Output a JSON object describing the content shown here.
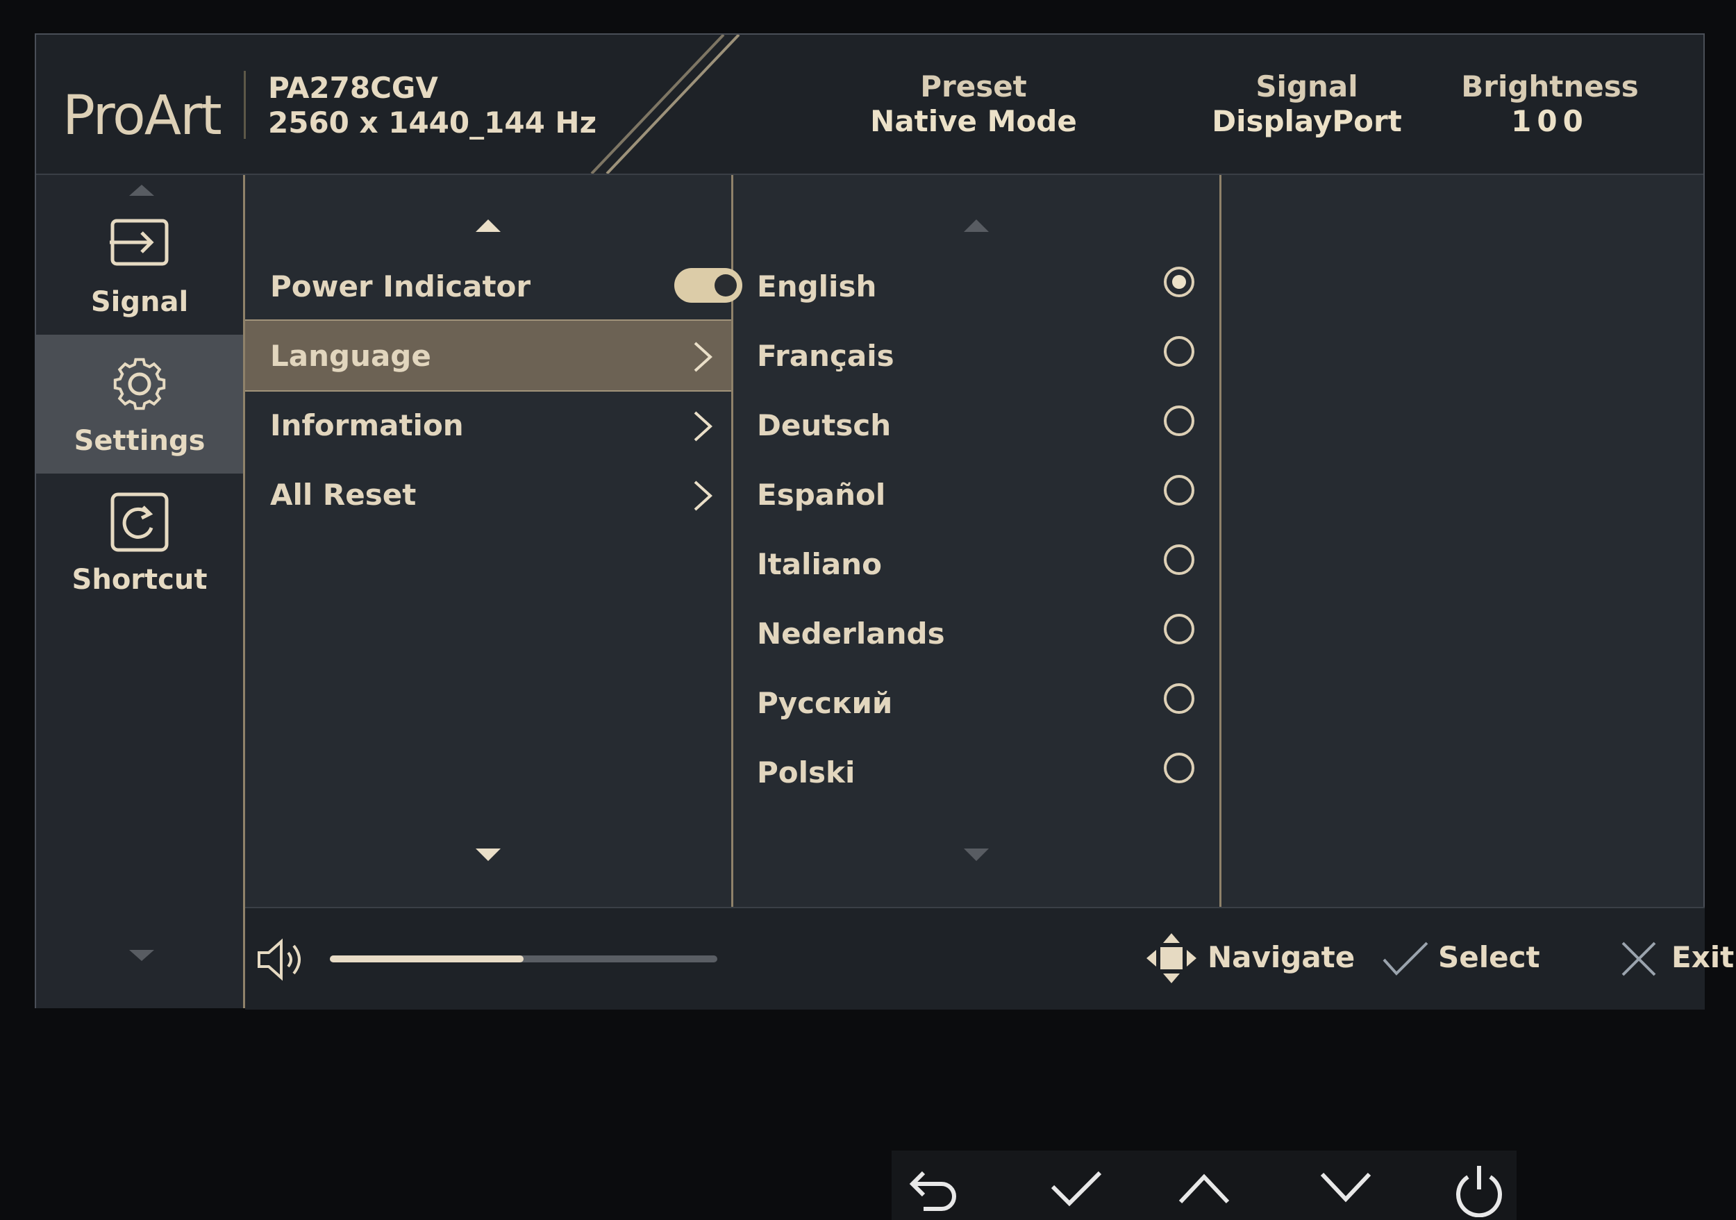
{
  "header": {
    "logo": "ProArt",
    "model": "PA278CGV",
    "resolution": "2560 x 1440_144 Hz",
    "preset_label": "Preset",
    "preset_value": "Native Mode",
    "signal_label": "Signal",
    "signal_value": "DisplayPort",
    "brightness_label": "Brightness",
    "brightness_value": "100"
  },
  "sidebar": {
    "items": [
      {
        "label": "Signal",
        "icon": "signal-input-icon"
      },
      {
        "label": "Settings",
        "icon": "gear-icon",
        "active": true
      },
      {
        "label": "Shortcut",
        "icon": "shortcut-icon"
      }
    ]
  },
  "settings_menu": {
    "items": [
      {
        "label": "Power Indicator",
        "control": "toggle",
        "state": "on"
      },
      {
        "label": "Language",
        "control": "chevron",
        "selected": true
      },
      {
        "label": "Information",
        "control": "chevron"
      },
      {
        "label": "All Reset",
        "control": "chevron"
      }
    ]
  },
  "language_menu": {
    "selected": "English",
    "options": [
      "English",
      "Français",
      "Deutsch",
      "Español",
      "Italiano",
      "Nederlands",
      "Русский",
      "Polski"
    ]
  },
  "footer": {
    "volume_fraction": 0.5,
    "navigate_label": "Navigate",
    "select_label": "Select",
    "exit_label": "Exit"
  },
  "hardware_buttons": [
    "back-icon",
    "check-icon",
    "up-icon",
    "down-icon",
    "power-icon"
  ],
  "colors": {
    "accent": "#dccca8",
    "panel": "#262b31",
    "selected_row": "#6c6254"
  }
}
